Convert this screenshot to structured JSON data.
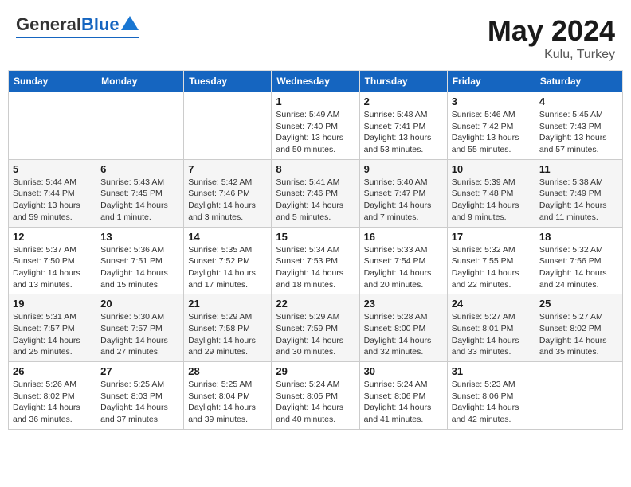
{
  "header": {
    "logo_general": "General",
    "logo_blue": "Blue",
    "month_year": "May 2024",
    "location": "Kulu, Turkey"
  },
  "weekdays": [
    "Sunday",
    "Monday",
    "Tuesday",
    "Wednesday",
    "Thursday",
    "Friday",
    "Saturday"
  ],
  "weeks": [
    [
      {
        "day": "",
        "sunrise": "",
        "sunset": "",
        "daylight": ""
      },
      {
        "day": "",
        "sunrise": "",
        "sunset": "",
        "daylight": ""
      },
      {
        "day": "",
        "sunrise": "",
        "sunset": "",
        "daylight": ""
      },
      {
        "day": "1",
        "sunrise": "Sunrise: 5:49 AM",
        "sunset": "Sunset: 7:40 PM",
        "daylight": "Daylight: 13 hours and 50 minutes."
      },
      {
        "day": "2",
        "sunrise": "Sunrise: 5:48 AM",
        "sunset": "Sunset: 7:41 PM",
        "daylight": "Daylight: 13 hours and 53 minutes."
      },
      {
        "day": "3",
        "sunrise": "Sunrise: 5:46 AM",
        "sunset": "Sunset: 7:42 PM",
        "daylight": "Daylight: 13 hours and 55 minutes."
      },
      {
        "day": "4",
        "sunrise": "Sunrise: 5:45 AM",
        "sunset": "Sunset: 7:43 PM",
        "daylight": "Daylight: 13 hours and 57 minutes."
      }
    ],
    [
      {
        "day": "5",
        "sunrise": "Sunrise: 5:44 AM",
        "sunset": "Sunset: 7:44 PM",
        "daylight": "Daylight: 13 hours and 59 minutes."
      },
      {
        "day": "6",
        "sunrise": "Sunrise: 5:43 AM",
        "sunset": "Sunset: 7:45 PM",
        "daylight": "Daylight: 14 hours and 1 minute."
      },
      {
        "day": "7",
        "sunrise": "Sunrise: 5:42 AM",
        "sunset": "Sunset: 7:46 PM",
        "daylight": "Daylight: 14 hours and 3 minutes."
      },
      {
        "day": "8",
        "sunrise": "Sunrise: 5:41 AM",
        "sunset": "Sunset: 7:46 PM",
        "daylight": "Daylight: 14 hours and 5 minutes."
      },
      {
        "day": "9",
        "sunrise": "Sunrise: 5:40 AM",
        "sunset": "Sunset: 7:47 PM",
        "daylight": "Daylight: 14 hours and 7 minutes."
      },
      {
        "day": "10",
        "sunrise": "Sunrise: 5:39 AM",
        "sunset": "Sunset: 7:48 PM",
        "daylight": "Daylight: 14 hours and 9 minutes."
      },
      {
        "day": "11",
        "sunrise": "Sunrise: 5:38 AM",
        "sunset": "Sunset: 7:49 PM",
        "daylight": "Daylight: 14 hours and 11 minutes."
      }
    ],
    [
      {
        "day": "12",
        "sunrise": "Sunrise: 5:37 AM",
        "sunset": "Sunset: 7:50 PM",
        "daylight": "Daylight: 14 hours and 13 minutes."
      },
      {
        "day": "13",
        "sunrise": "Sunrise: 5:36 AM",
        "sunset": "Sunset: 7:51 PM",
        "daylight": "Daylight: 14 hours and 15 minutes."
      },
      {
        "day": "14",
        "sunrise": "Sunrise: 5:35 AM",
        "sunset": "Sunset: 7:52 PM",
        "daylight": "Daylight: 14 hours and 17 minutes."
      },
      {
        "day": "15",
        "sunrise": "Sunrise: 5:34 AM",
        "sunset": "Sunset: 7:53 PM",
        "daylight": "Daylight: 14 hours and 18 minutes."
      },
      {
        "day": "16",
        "sunrise": "Sunrise: 5:33 AM",
        "sunset": "Sunset: 7:54 PM",
        "daylight": "Daylight: 14 hours and 20 minutes."
      },
      {
        "day": "17",
        "sunrise": "Sunrise: 5:32 AM",
        "sunset": "Sunset: 7:55 PM",
        "daylight": "Daylight: 14 hours and 22 minutes."
      },
      {
        "day": "18",
        "sunrise": "Sunrise: 5:32 AM",
        "sunset": "Sunset: 7:56 PM",
        "daylight": "Daylight: 14 hours and 24 minutes."
      }
    ],
    [
      {
        "day": "19",
        "sunrise": "Sunrise: 5:31 AM",
        "sunset": "Sunset: 7:57 PM",
        "daylight": "Daylight: 14 hours and 25 minutes."
      },
      {
        "day": "20",
        "sunrise": "Sunrise: 5:30 AM",
        "sunset": "Sunset: 7:57 PM",
        "daylight": "Daylight: 14 hours and 27 minutes."
      },
      {
        "day": "21",
        "sunrise": "Sunrise: 5:29 AM",
        "sunset": "Sunset: 7:58 PM",
        "daylight": "Daylight: 14 hours and 29 minutes."
      },
      {
        "day": "22",
        "sunrise": "Sunrise: 5:29 AM",
        "sunset": "Sunset: 7:59 PM",
        "daylight": "Daylight: 14 hours and 30 minutes."
      },
      {
        "day": "23",
        "sunrise": "Sunrise: 5:28 AM",
        "sunset": "Sunset: 8:00 PM",
        "daylight": "Daylight: 14 hours and 32 minutes."
      },
      {
        "day": "24",
        "sunrise": "Sunrise: 5:27 AM",
        "sunset": "Sunset: 8:01 PM",
        "daylight": "Daylight: 14 hours and 33 minutes."
      },
      {
        "day": "25",
        "sunrise": "Sunrise: 5:27 AM",
        "sunset": "Sunset: 8:02 PM",
        "daylight": "Daylight: 14 hours and 35 minutes."
      }
    ],
    [
      {
        "day": "26",
        "sunrise": "Sunrise: 5:26 AM",
        "sunset": "Sunset: 8:02 PM",
        "daylight": "Daylight: 14 hours and 36 minutes."
      },
      {
        "day": "27",
        "sunrise": "Sunrise: 5:25 AM",
        "sunset": "Sunset: 8:03 PM",
        "daylight": "Daylight: 14 hours and 37 minutes."
      },
      {
        "day": "28",
        "sunrise": "Sunrise: 5:25 AM",
        "sunset": "Sunset: 8:04 PM",
        "daylight": "Daylight: 14 hours and 39 minutes."
      },
      {
        "day": "29",
        "sunrise": "Sunrise: 5:24 AM",
        "sunset": "Sunset: 8:05 PM",
        "daylight": "Daylight: 14 hours and 40 minutes."
      },
      {
        "day": "30",
        "sunrise": "Sunrise: 5:24 AM",
        "sunset": "Sunset: 8:06 PM",
        "daylight": "Daylight: 14 hours and 41 minutes."
      },
      {
        "day": "31",
        "sunrise": "Sunrise: 5:23 AM",
        "sunset": "Sunset: 8:06 PM",
        "daylight": "Daylight: 14 hours and 42 minutes."
      },
      {
        "day": "",
        "sunrise": "",
        "sunset": "",
        "daylight": ""
      }
    ]
  ]
}
